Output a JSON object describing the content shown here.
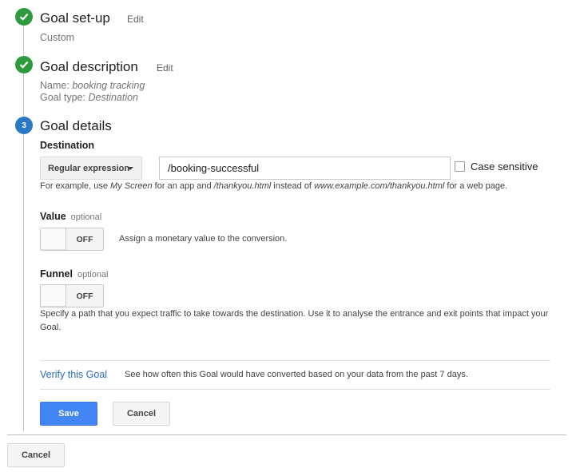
{
  "steps": [
    {
      "title": "Goal set-up",
      "edit": "Edit",
      "detail": "Custom"
    },
    {
      "title": "Goal description",
      "edit": "Edit",
      "name_label": "Name:",
      "name_value": "booking tracking",
      "type_label": "Goal type:",
      "type_value": "Destination"
    },
    {
      "number": "3",
      "title": "Goal details"
    }
  ],
  "destination": {
    "label": "Destination",
    "match_type": "Regular expression",
    "value": "/booking-successful",
    "case_sensitive_label": "Case sensitive",
    "case_sensitive_checked": false,
    "hint": {
      "p1": "For example, use ",
      "e1": "My Screen",
      "p2": " for an app and ",
      "e2": "/thankyou.html",
      "p3": " instead of ",
      "e3": "www.example.com/thankyou.html",
      "p4": " for a web page."
    }
  },
  "value": {
    "label": "Value",
    "optional": "optional",
    "toggle_state": "OFF",
    "description": "Assign a monetary value to the conversion."
  },
  "funnel": {
    "label": "Funnel",
    "optional": "optional",
    "toggle_state": "OFF",
    "description": "Specify a path that you expect traffic to take towards the destination. Use it to analyse the entrance and exit points that impact your Goal."
  },
  "verify": {
    "link": "Verify this Goal",
    "description": "See how often this Goal would have converted based on your data from the past 7 days."
  },
  "actions": {
    "save": "Save",
    "cancel": "Cancel"
  },
  "footer": {
    "cancel": "Cancel"
  },
  "colors": {
    "done": "#2e9a3e",
    "active": "#2a79c4",
    "primary": "#4285f4",
    "link": "#2a6ebb"
  }
}
